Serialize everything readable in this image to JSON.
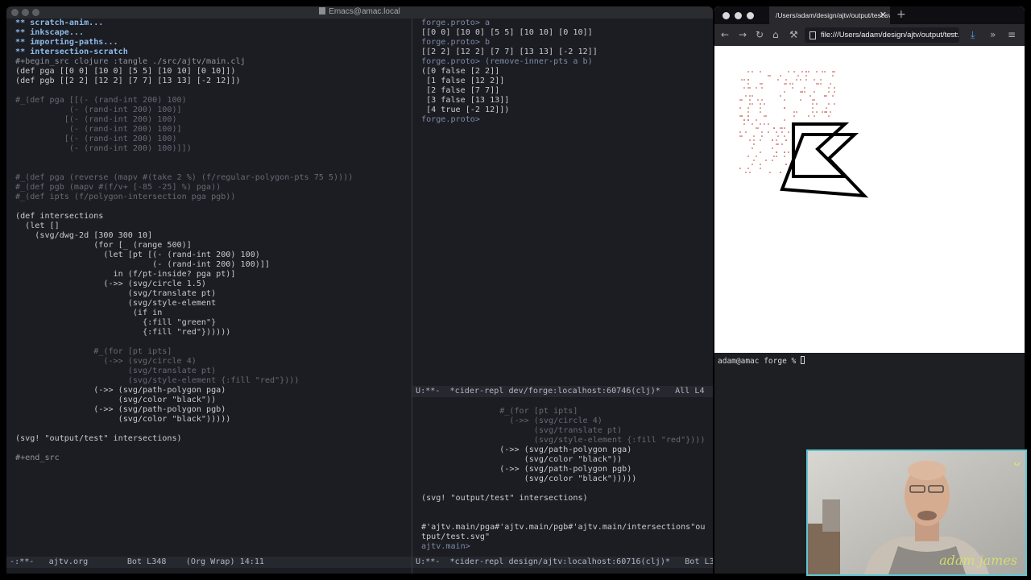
{
  "emacs": {
    "window_title": "Emacs@amac.local",
    "left_buffer": [
      "** scratch-anim...",
      "** inkscape...",
      "** importing-paths...",
      "** intersection-scratch",
      "#+begin_src clojure :tangle ./src/ajtv/main.clj",
      "(def pga [[0 0] [10 0] [5 5] [10 10] [0 10]])",
      "(def pgb [[2 2] [12 2] [7 7] [13 13] [-2 12]])",
      "",
      "#_(def pga [[(- (rand-int 200) 100)",
      "           (- (rand-int 200) 100)]",
      "          [(- (rand-int 200) 100)",
      "           (- (rand-int 200) 100)]",
      "          [(- (rand-int 200) 100)",
      "           (- (rand-int 200) 100)]])",
      "",
      "",
      "#_(def pga (reverse (mapv #(take 2 %) (f/regular-polygon-pts 75 5))))",
      "#_(def pgb (mapv #(f/v+ [-85 -25] %) pga))",
      "#_(def ipts (f/polygon-intersection pga pgb))",
      "",
      "(def intersections",
      "  (let []",
      "    (svg/dwg-2d [300 300 10]",
      "                (for [_ (range 500)]",
      "                  (let [pt [(- (rand-int 200) 100)",
      "                            (- (rand-int 200) 100)]]",
      "                    in (f/pt-inside? pga pt)]",
      "                  (->> (svg/circle 1.5)",
      "                       (svg/translate pt)",
      "                       (svg/style-element",
      "                        (if in",
      "                          {:fill \"green\"}",
      "                          {:fill \"red\"})))))",
      "",
      "                #_(for [pt ipts]",
      "                  (->> (svg/circle 4)",
      "                       (svg/translate pt)",
      "                       (svg/style-element {:fill \"red\"})))",
      "                (->> (svg/path-polygon pga)",
      "                     (svg/color \"black\"))",
      "                (->> (svg/path-polygon pgb)",
      "                     (svg/color \"black\")))))",
      "",
      "(svg! \"output/test\" intersections)",
      "",
      "#+end_src"
    ],
    "left_modeline": "-:**-   ajtv.org        Bot L348    (Org Wrap) 14:11",
    "repl_top": [
      "forge.proto> a",
      "[[0 0] [10 0] [5 5] [10 10] [0 10]]",
      "forge.proto> b",
      "[[2 2] [12 2] [7 7] [13 13] [-2 12]]",
      "forge.proto> (remove-inner-pts a b)",
      "([0 false [2 2]]",
      " [1 false [12 2]]",
      " [2 false [7 7]]",
      " [3 false [13 13]]",
      " [4 true [-2 12]])",
      "forge.proto> "
    ],
    "repl_top_modeline": "U:**-  *cider-repl dev/forge:localhost:60746(clj)*   All L4",
    "repl_bottom": [
      "",
      "                #_(for [pt ipts]",
      "                  (->> (svg/circle 4)",
      "                       (svg/translate pt)",
      "                       (svg/style-element {:fill \"red\"})))",
      "                (->> (svg/path-polygon pga)",
      "                     (svg/color \"black\"))",
      "                (->> (svg/path-polygon pgb)",
      "                     (svg/color \"black\")))))",
      "",
      "(svg! \"output/test\" intersections)",
      "",
      "",
      "#'ajtv.main/pga#'ajtv.main/pgb#'ajtv.main/intersections\"ou",
      "tput/test.svg\"",
      "ajtv.main> "
    ],
    "repl_bottom_modeline": "U:**-  *cider-repl design/ajtv:localhost:60716(clj)*   Bot L3"
  },
  "firefox": {
    "tab_title": "/Users/adam/design/ajtv/output/test.svg",
    "url": "file:///Users/adam/design/ajtv/output/test.svg"
  },
  "terminal": {
    "prompt": "adam@amac forge % "
  },
  "webcam": {
    "watermark": "adam james"
  }
}
